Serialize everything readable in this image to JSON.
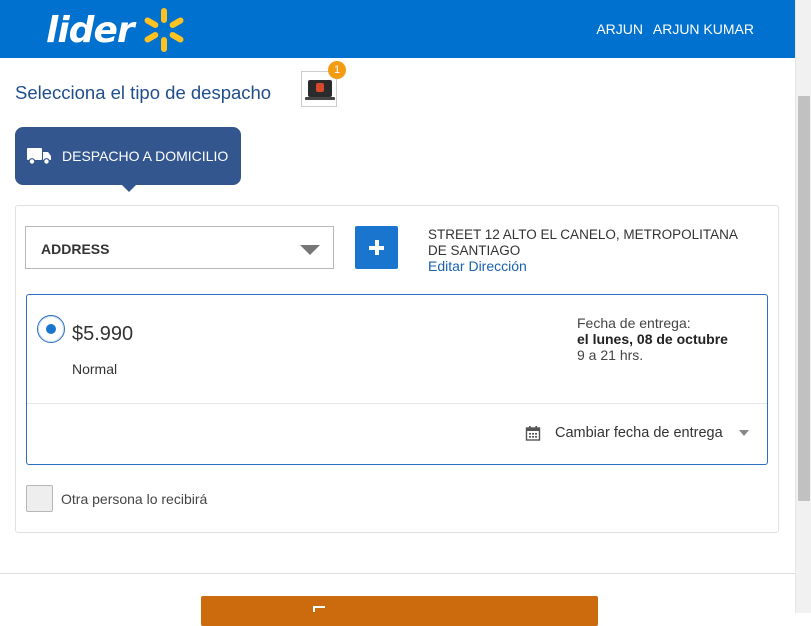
{
  "header": {
    "logo_text": "lider",
    "user_first": "ARJUN",
    "user_full": "ARJUN KUMAR"
  },
  "page_title": "Selecciona el tipo de despacho",
  "cart": {
    "badge_count": "1"
  },
  "delivery_tab": {
    "label": "DESPACHO A DOMICILIO"
  },
  "address": {
    "select_value": "ADDRESS",
    "text": "STREET 12 ALTO EL CANELO, METROPOLITANA DE SANTIAGO",
    "edit_link": "Editar Dirección"
  },
  "shipping_option": {
    "price": "$5.990",
    "method": "Normal",
    "delivery_label": "Fecha de entrega:",
    "delivery_date": "el lunes, 08 de octubre",
    "delivery_hours": "9 a 21 hrs.",
    "change_date": "Cambiar fecha de entrega",
    "selected": true
  },
  "other_person": {
    "label": "Otra persona lo recibirá",
    "checked": false
  },
  "colors": {
    "header": "#0071ce",
    "spark": "#ffc220",
    "tab": "#33568f",
    "accent": "#1a75cf",
    "continue": "#cc6a0e",
    "badge": "#f39c12"
  }
}
